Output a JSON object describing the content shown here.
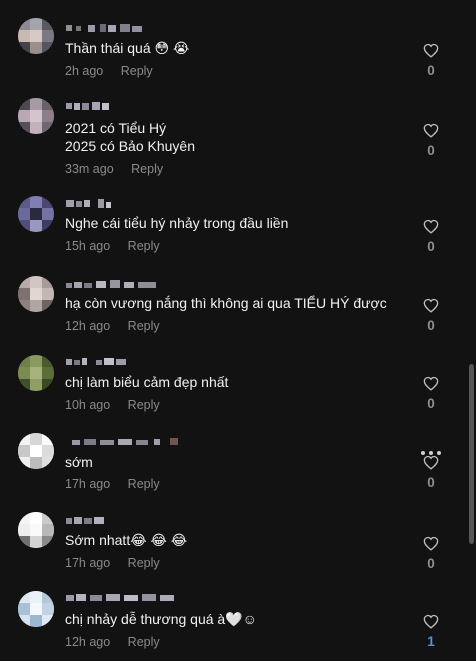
{
  "comments": [
    {
      "text": "Thần thái quá 😳 😭",
      "time": "2h ago",
      "reply": "Reply",
      "likes": "0"
    },
    {
      "text": "2021 có Tiểu Hý",
      "text2": "2025 có Bảo Khuyên",
      "time": "33m ago",
      "reply": "Reply",
      "likes": "0"
    },
    {
      "text": "Nghe cái tiểu hý nhảy trong đầu liền",
      "time": "15h ago",
      "reply": "Reply",
      "likes": "0"
    },
    {
      "text": "hạ còn vương nắng thì không ai qua TIỂU HÝ được",
      "time": "12h ago",
      "reply": "Reply",
      "likes": "0"
    },
    {
      "text": "chị làm biểu cảm đẹp nhất",
      "time": "10h ago",
      "reply": "Reply",
      "likes": "0"
    },
    {
      "text": "sớm",
      "time": "17h ago",
      "reply": "Reply",
      "likes": "0"
    },
    {
      "text": "Sớm nhatt😂 😂 😂",
      "time": "17h ago",
      "reply": "Reply",
      "likes": "0"
    },
    {
      "text": "chị nhảy dễ thương quá à🤍☺",
      "time": "12h ago",
      "reply": "Reply",
      "likes": "1"
    }
  ],
  "colors": {
    "background": "#121212",
    "text": "#f1f1f1",
    "meta": "#8a8a8a",
    "liked_count": "#5b8fd6"
  },
  "icons": {
    "like": "heart-outline-icon",
    "more": "more-horizontal-icon"
  }
}
